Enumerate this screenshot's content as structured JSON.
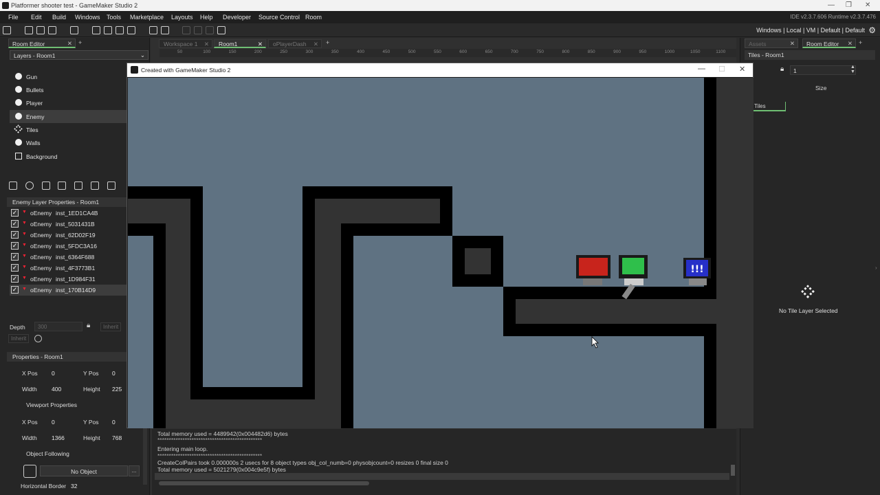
{
  "titlebar": {
    "title": "Platformer shooter test - GameMaker Studio 2"
  },
  "menu": [
    "File",
    "Edit",
    "Build",
    "Windows",
    "Tools",
    "Marketplace",
    "Layouts",
    "Help",
    "Developer",
    "Source Control",
    "Room"
  ],
  "versions": "IDE v2.3.7.606  Runtime v2.3.7.476",
  "toolbar": {
    "targets": "Windows | Local | VM | Default | Default"
  },
  "left": {
    "tab": "Room Editor",
    "layers_dropdown": "Layers - Room1",
    "layers": [
      "Gun",
      "Bullets",
      "Player",
      "Enemy",
      "Tiles",
      "Walls",
      "Background"
    ],
    "layer_props_title": "Enemy Layer Properties - Room1",
    "instances": [
      {
        "obj": "oEnemy",
        "id": "inst_1ED1CA4B"
      },
      {
        "obj": "oEnemy",
        "id": "inst_5031431B"
      },
      {
        "obj": "oEnemy",
        "id": "inst_62D02F19"
      },
      {
        "obj": "oEnemy",
        "id": "inst_5FDC3A16"
      },
      {
        "obj": "oEnemy",
        "id": "inst_6364F688"
      },
      {
        "obj": "oEnemy",
        "id": "inst_4F3773B1"
      },
      {
        "obj": "oEnemy",
        "id": "inst_1D984F31"
      },
      {
        "obj": "oEnemy",
        "id": "inst_170B14D9"
      }
    ],
    "depth_label": "Depth",
    "depth_value": "300",
    "inherit": "Inherit",
    "props_title": "Properties - Room1",
    "xpos_label": "X Pos",
    "xpos": "0",
    "ypos_label": "Y Pos",
    "ypos": "0",
    "width_label": "Width",
    "width": "400",
    "height_label": "Height",
    "height": "225",
    "viewport_title": "Viewport Properties",
    "vxpos": "0",
    "vypos": "0",
    "vwidth": "1366",
    "vheight": "768",
    "object_following": "Object Following",
    "no_object": "No Object",
    "ellipsis": "...",
    "horizontal_border": "Horizontal Border",
    "horizontal_border_value": "32"
  },
  "center": {
    "tabs": [
      "Workspace 1",
      "Room1",
      "oPlayerDash"
    ],
    "ruler_ticks": [
      "50",
      "100",
      "150",
      "200",
      "250",
      "300",
      "350",
      "400",
      "450",
      "500",
      "550",
      "600",
      "650",
      "700",
      "750",
      "800",
      "850",
      "900",
      "950",
      "1000",
      "1050",
      "1100"
    ],
    "output_lines": [
      "Total memory used = 4489942(0x004482d6) bytes",
      "**********************************************",
      "Entering main loop.",
      "**********************************************",
      "CreateColPairs took 0.000000s 2 usecs for 8 object types obj_col_numb=0 physobjcount=0 resizes 0 final size 0",
      "Total memory used = 5021279(0x004c9e5f) bytes"
    ]
  },
  "right": {
    "tabs": [
      "Assets",
      "Room Editor"
    ],
    "tiles_title": "Tiles - Room1",
    "size_value": "1",
    "size_label": "Size",
    "tiles_tab": "Tiles",
    "no_tile_layer": "No Tile Layer Selected"
  },
  "game": {
    "window_title": "Created with GameMaker Studio 2",
    "enemy_sign": "!!!"
  },
  "colors": {
    "sky": "#5f7282",
    "wall": "#000000",
    "wall_fill": "#333333",
    "enemy_red": "#c8241c",
    "player_green": "#2fbf4b",
    "enemy_blue": "#2730c8",
    "accent": "#6fbf73"
  }
}
